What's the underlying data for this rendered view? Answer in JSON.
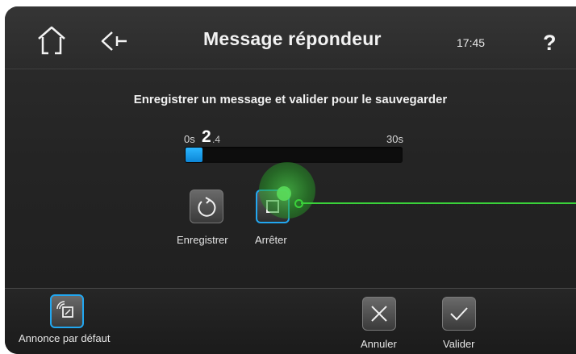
{
  "header": {
    "title": "Message répondeur",
    "time": "17:45",
    "help": "?",
    "home_icon": "home-icon",
    "back_icon": "back-arrow-icon"
  },
  "instruction": "Enregistrer un message et valider pour le sauvegarder",
  "recording": {
    "min_label": "0s",
    "current_int": "2",
    "current_dec": ".4",
    "max_label": "30s",
    "progress_seconds": 2.4,
    "max_seconds": 30
  },
  "controls": {
    "record_label": "Enregistrer",
    "record_icon": "record-refresh-icon",
    "stop_label": "Arrêter",
    "stop_icon": "stop-square-icon"
  },
  "footer": {
    "default_label": "Annonce par défaut",
    "default_icon": "default-announcement-icon",
    "cancel_label": "Annuler",
    "cancel_icon": "cancel-x-icon",
    "validate_label": "Valider",
    "validate_icon": "check-icon"
  },
  "colors": {
    "accent": "#22a7f0",
    "progress": "#1a9be6",
    "pointer": "#3ad13a"
  }
}
